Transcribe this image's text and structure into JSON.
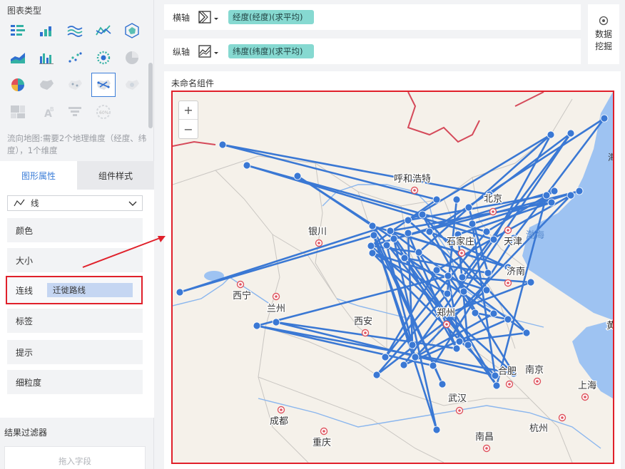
{
  "left_panel": {
    "chart_type_title": "图表类型",
    "description": "流向地图:需要2个地理维度（经度、纬度），1个维度",
    "tabs": [
      "图形属性",
      "组件样式"
    ],
    "line_type": "线",
    "props": {
      "color": "颜色",
      "size": "大小",
      "connect_label": "连线",
      "connect_value": "迁徙路线",
      "label": "标签",
      "tooltip": "提示",
      "granularity": "细粒度"
    },
    "filter_title": "结果过滤器",
    "filter_placeholder": "拖入字段"
  },
  "axes": {
    "x_label": "横轴",
    "x_field": "经度(经度)(求平均)",
    "y_label": "纵轴",
    "y_field": "纬度(纬度)(求平均)"
  },
  "data_mining": "数据挖掘",
  "component_title": "未命名组件",
  "map": {
    "zoom_in": "+",
    "zoom_out": "−",
    "cities": [
      "呼和浩特",
      "北京",
      "天津",
      "石家庄",
      "济南",
      "银川",
      "西宁",
      "兰州",
      "西安",
      "郑州",
      "合肥",
      "南京",
      "上海",
      "武汉",
      "成都",
      "重庆",
      "南昌",
      "杭州",
      "渤海",
      "黄"
    ],
    "cities_partial": {
      "tianjin_prefix": "天",
      "xi_partial": "渤海"
    },
    "edge_text": "海"
  },
  "colors": {
    "route": "#3a78d4",
    "highlight": "#e0202a",
    "pill": "#86d9d1",
    "accent": "#3b7dd8"
  }
}
